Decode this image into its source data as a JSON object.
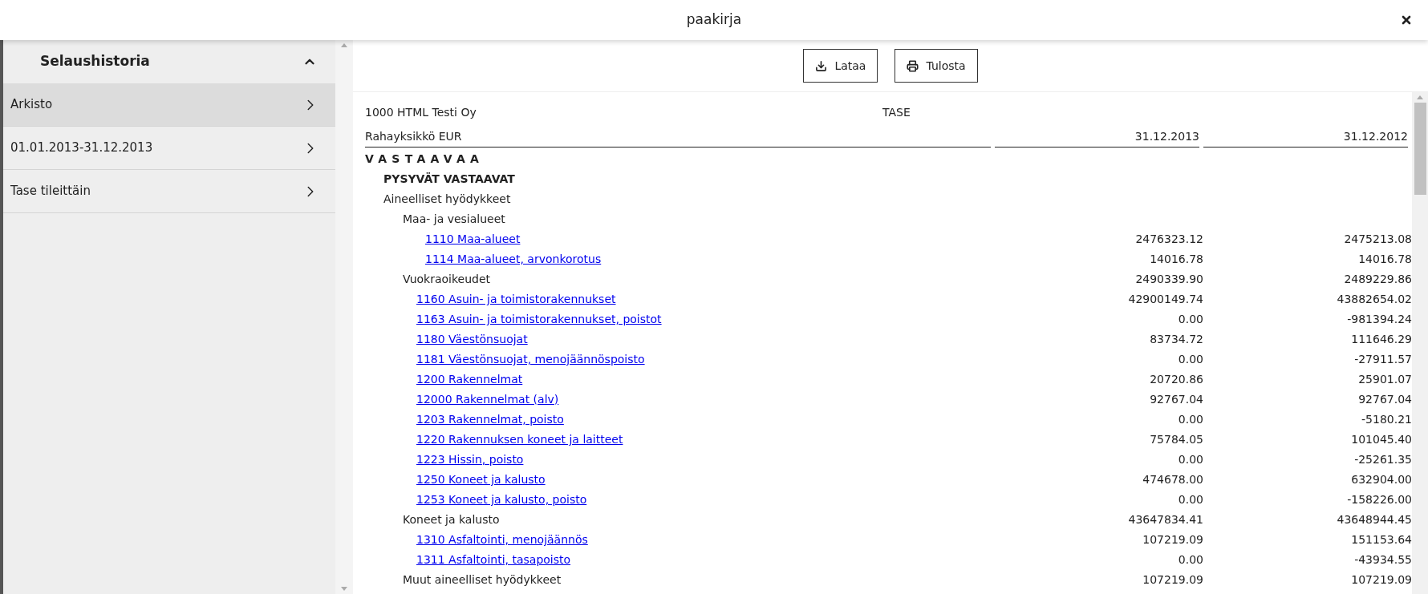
{
  "dialog": {
    "title": "paakirja"
  },
  "sidebar": {
    "title": "Selaushistoria",
    "expanded": true,
    "items": [
      {
        "label": "Arkisto",
        "selected": true
      },
      {
        "label": "01.01.2013-31.12.2013",
        "selected": false
      },
      {
        "label": "Tase tileittäin",
        "selected": false
      }
    ]
  },
  "toolbar": {
    "buttons": [
      {
        "label": "Lataa",
        "kind": "download"
      },
      {
        "label": "Tulosta",
        "kind": "print"
      }
    ]
  },
  "report": {
    "company": "1000 HTML Testi Oy",
    "title": "TASE",
    "currency": "Rahayksikkö EUR",
    "columns": [
      "31.12.2013",
      "31.12.2012"
    ],
    "rows": [
      {
        "kind": "section",
        "label": "VASTAAVAA",
        "children": [
          {
            "kind": "heading",
            "label": "PYSYVÄT VASTAAVAT",
            "children": [
              {
                "kind": "group",
                "label": "Aineelliset hyödykkeet",
                "children": [
                  {
                    "kind": "group",
                    "label": "Maa- ja vesialueet",
                    "children": [
                      {
                        "kind": "account",
                        "label": "1110 Maa-alueet",
                        "values": [
                          "2476323.12",
                          "2475213.08"
                        ]
                      },
                      {
                        "kind": "account",
                        "label": "1114 Maa-alueet, arvonkorotus",
                        "values": [
                          "14016.78",
                          "14016.78"
                        ]
                      }
                    ]
                  },
                  {
                    "kind": "total",
                    "label": "Vuokraoikeudet",
                    "values": [
                      "2490339.90",
                      "2489229.86"
                    ]
                  },
                  {
                    "kind": "account",
                    "label": "1160 Asuin- ja toimistorakennukset",
                    "values": [
                      "42900149.74",
                      "43882654.02"
                    ]
                  },
                  {
                    "kind": "account",
                    "label": "1163 Asuin- ja toimistorakennukset, poistot",
                    "values": [
                      "0.00",
                      "-981394.24"
                    ]
                  },
                  {
                    "kind": "account",
                    "label": "1180 Väestönsuojat",
                    "values": [
                      "83734.72",
                      "111646.29"
                    ]
                  },
                  {
                    "kind": "account",
                    "label": "1181 Väestönsuojat, menojäännöspoisto",
                    "values": [
                      "0.00",
                      "-27911.57"
                    ]
                  },
                  {
                    "kind": "account",
                    "label": "1200 Rakennelmat",
                    "values": [
                      "20720.86",
                      "25901.07"
                    ]
                  },
                  {
                    "kind": "account",
                    "label": "12000 Rakennelmat (alv)",
                    "values": [
                      "92767.04",
                      "92767.04"
                    ]
                  },
                  {
                    "kind": "account",
                    "label": "1203 Rakennelmat, poisto",
                    "values": [
                      "0.00",
                      "-5180.21"
                    ]
                  },
                  {
                    "kind": "account",
                    "label": "1220 Rakennuksen koneet ja laitteet",
                    "values": [
                      "75784.05",
                      "101045.40"
                    ]
                  },
                  {
                    "kind": "account",
                    "label": "1223 Hissin, poisto",
                    "values": [
                      "0.00",
                      "-25261.35"
                    ]
                  },
                  {
                    "kind": "account",
                    "label": "1250 Koneet ja kalusto",
                    "values": [
                      "474678.00",
                      "632904.00"
                    ]
                  },
                  {
                    "kind": "account",
                    "label": "1253 Koneet ja kalusto, poisto",
                    "values": [
                      "0.00",
                      "-158226.00"
                    ]
                  },
                  {
                    "kind": "total",
                    "label": "Koneet ja kalusto",
                    "values": [
                      "43647834.41",
                      "43648944.45"
                    ]
                  },
                  {
                    "kind": "account",
                    "label": "1310 Asfaltointi, menojäännös",
                    "values": [
                      "107219.09",
                      "151153.64"
                    ]
                  },
                  {
                    "kind": "account",
                    "label": "1311 Asfaltointi, tasapoisto",
                    "values": [
                      "0.00",
                      "-43934.55"
                    ]
                  },
                  {
                    "kind": "total",
                    "label": "Muut aineelliset hyödykkeet",
                    "values": [
                      "107219.09",
                      "107219.09"
                    ]
                  }
                ]
              }
            ]
          }
        ]
      }
    ]
  }
}
